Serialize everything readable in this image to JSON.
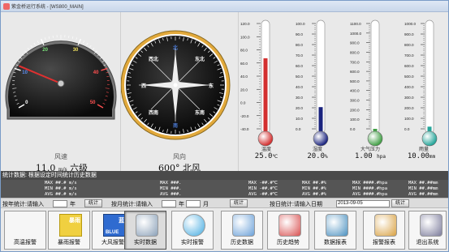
{
  "window": {
    "title": "紫金桥运行系统 - [WS800_MAIN]"
  },
  "wind_speed": {
    "label": "风速",
    "value": "11.0",
    "unit": "m/s",
    "grade": "六级",
    "needle_value": 11.0,
    "scale_max": 50,
    "ticks": [
      "0",
      "10",
      "20",
      "30",
      "40",
      "50"
    ]
  },
  "wind_direction": {
    "label": "风向",
    "value": "600°",
    "direction": "北风",
    "compass": {
      "n": "北",
      "s": "南",
      "e": "东",
      "w": "西",
      "ne": "东北",
      "nw": "西北",
      "se": "东南",
      "sw": "西南"
    }
  },
  "temperature": {
    "label": "温度",
    "value": "25.0",
    "unit": "℃",
    "fill_fraction": 0.65,
    "ticks": [
      "120.0",
      "100.0",
      "80.0",
      "60.0",
      "40.0",
      "20.0",
      "0.0",
      "-20.0",
      "-40.0"
    ],
    "color": "#d32f2f"
  },
  "humidity": {
    "label": "湿度",
    "value": "20.0",
    "unit": "%",
    "fill_fraction": 0.2,
    "ticks": [
      "100.0",
      "90.0",
      "80.0",
      "70.0",
      "60.0",
      "50.0",
      "40.0",
      "30.0",
      "20.0",
      "10.0",
      "0.0"
    ],
    "color": "#1a237e"
  },
  "pressure": {
    "label": "大气压力",
    "value": "1.00",
    "unit": "hpa",
    "fill_fraction": 0.0,
    "ticks": [
      "1100.0",
      "1000.0",
      "900.0",
      "800.0",
      "700.0",
      "600.0",
      "500.0",
      "400.0",
      "300.0",
      "200.0",
      "100.0",
      "0.0"
    ],
    "color": "#43a047"
  },
  "rain": {
    "label": "雨量",
    "value": "10.00",
    "unit": "mm",
    "fill_fraction": 0.02,
    "ticks": [
      "1000.0",
      "900.0",
      "800.0",
      "700.0",
      "600.0",
      "500.0",
      "400.0",
      "300.0",
      "200.0",
      "100.0",
      "0.0"
    ],
    "color": "#26a69a"
  },
  "stats": {
    "header": "统计数据: 根据设定时间统计历史数据",
    "wind_col": [
      "MAX ##.# m/s",
      "MIN ##.# m/s",
      "AVG ##.# m/s"
    ],
    "dir_col": [
      "MAX ###.",
      "MIN ###.",
      "AVG ###."
    ],
    "temp_col": [
      "MAX -##.#℃",
      "MIN -##.#℃",
      "AVG -##.#℃"
    ],
    "hum_col": [
      "MAX ##.#%",
      "MIN ##.#%",
      "AVG ##.#%"
    ],
    "press_col": [
      "MAX ####.#hpa",
      "MIN ####.#hpa",
      "AVG ####.#hpa"
    ],
    "rain_col": [
      "MAX ##.##mm",
      "MIN ##.##mm",
      "AVG ##.##mm"
    ]
  },
  "filters": {
    "year_label": "按年统计:请输入",
    "year_suffix": "年",
    "year_btn": "统计",
    "month_label": "按月统计:请输入",
    "month_year": "年",
    "month_suffix": "月",
    "month_btn": "统计",
    "day_label": "按日统计:请输入日期",
    "day_value": "2013-09-05",
    "day_btn": "统计"
  },
  "toolbar": {
    "buttons": [
      {
        "label": "高温报警",
        "icon": "high-temp-alarm-icon"
      },
      {
        "label": "暴雨报警",
        "icon": "rainstorm-alarm-icon"
      },
      {
        "label": "大风报警",
        "icon": "gale-alarm-icon"
      },
      {
        "label": "实时数据",
        "icon": "realtime-data-icon"
      },
      {
        "label": "实时报警",
        "icon": "realtime-alarm-icon"
      },
      {
        "label": "历史数据",
        "icon": "history-data-icon"
      },
      {
        "label": "历史趋势",
        "icon": "history-trend-icon"
      },
      {
        "label": "数据报表",
        "icon": "data-report-icon"
      },
      {
        "label": "报警报表",
        "icon": "alarm-report-icon"
      },
      {
        "label": "退出系统",
        "icon": "exit-icon"
      }
    ],
    "alarm_badges": {
      "rain": "暴雨",
      "gale": "蓝",
      "blue_text": "BLUE"
    }
  }
}
